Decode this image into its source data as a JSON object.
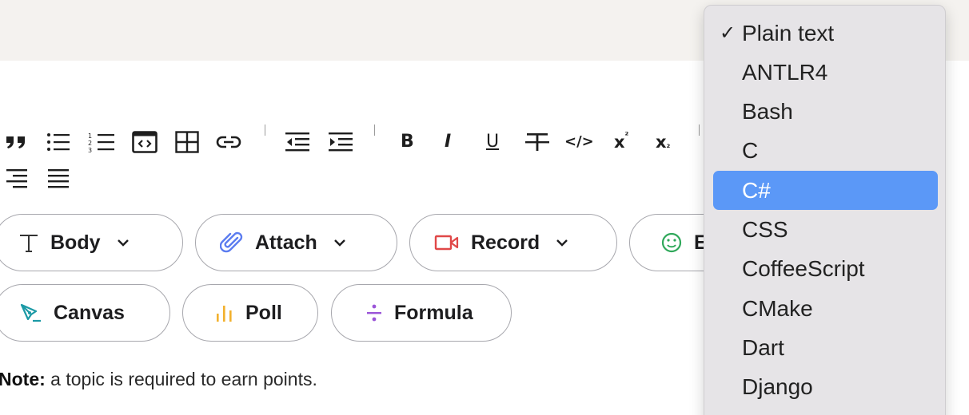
{
  "toolbar": {
    "icons": [
      "blockquote-icon",
      "bullet-list-icon",
      "numbered-list-icon",
      "code-block-icon",
      "table-icon",
      "link-icon",
      "outdent-icon",
      "indent-icon",
      "bold-icon",
      "italic-icon",
      "underline-icon",
      "strikethrough-icon",
      "inline-code-icon",
      "superscript-icon",
      "subscript-icon",
      "align-right-icon",
      "justify-icon"
    ],
    "bold_label": "B",
    "italic_label": "I",
    "underline_label": "U",
    "code_label": "</>",
    "superscript_label": "x",
    "superscript_mark": "²",
    "subscript_label": "x",
    "subscript_mark": "₂"
  },
  "buttons": {
    "body": {
      "label": "Body",
      "icon": "text-type-icon"
    },
    "attach": {
      "label": "Attach",
      "icon": "paperclip-icon",
      "color": "#5b7cf0"
    },
    "record": {
      "label": "Record",
      "icon": "video-camera-icon",
      "color": "#e04848"
    },
    "emoji": {
      "label": "E",
      "icon": "smiley-icon",
      "color": "#2fa85a"
    },
    "canvas": {
      "label": "Canvas",
      "icon": "pen-nib-icon",
      "color": "#1c9aa6"
    },
    "poll": {
      "label": "Poll",
      "icon": "bar-chart-icon",
      "color": "#f2b12e"
    },
    "formula": {
      "label": "Formula",
      "icon": "divide-icon",
      "color": "#9b55d8"
    }
  },
  "note": {
    "prefix": "Note:",
    "text": " a topic is required to earn points."
  },
  "dropdown": {
    "check": "✓",
    "items": [
      "Plain text",
      "ANTLR4",
      "Bash",
      "C",
      "C#",
      "CSS",
      "CoffeeScript",
      "CMake",
      "Dart",
      "Django"
    ],
    "checked_index": 0,
    "highlighted_index": 4,
    "highlight_color": "#5b98f7"
  }
}
